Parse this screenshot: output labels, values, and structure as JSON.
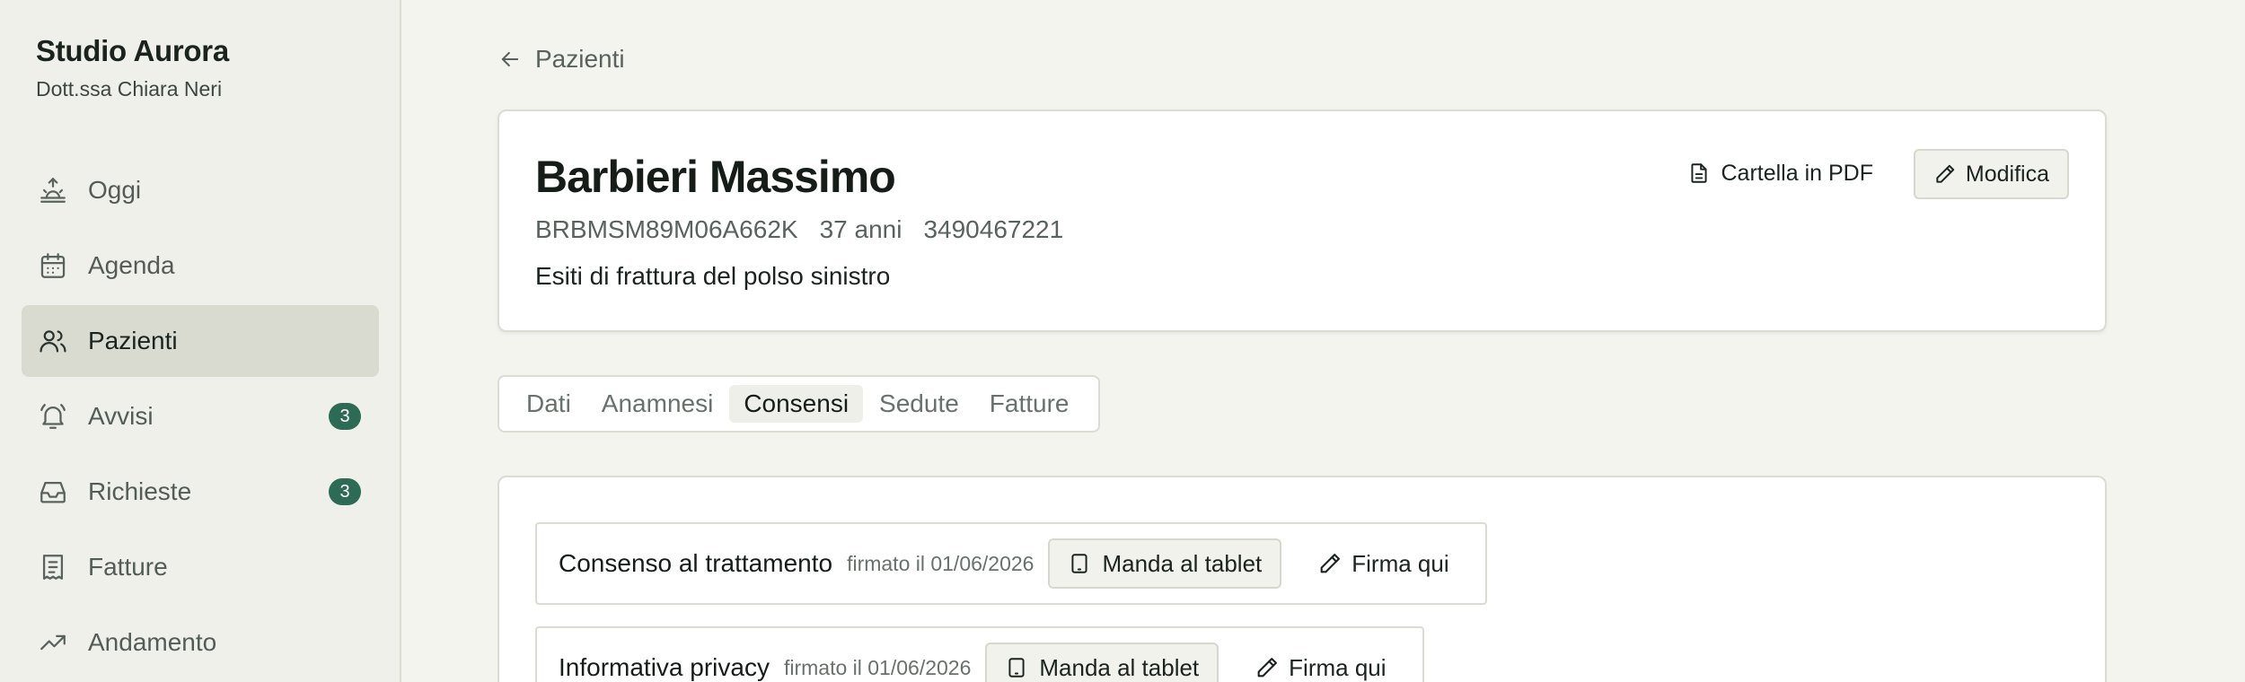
{
  "sidebar": {
    "brand": "Studio Aurora",
    "subtitle": "Dott.ssa Chiara Neri",
    "items": [
      {
        "label": "Oggi",
        "icon": "sunrise-icon"
      },
      {
        "label": "Agenda",
        "icon": "calendar-icon"
      },
      {
        "label": "Pazienti",
        "icon": "users-icon",
        "active": true
      },
      {
        "label": "Avvisi",
        "icon": "bell-icon",
        "badge": "3"
      },
      {
        "label": "Richieste",
        "icon": "inbox-icon",
        "badge": "3"
      },
      {
        "label": "Fatture",
        "icon": "receipt-icon"
      },
      {
        "label": "Andamento",
        "icon": "trending-up-icon"
      }
    ]
  },
  "breadcrumb": {
    "back_label": "Pazienti",
    "icon": "arrow-left-icon"
  },
  "patient": {
    "name": "Barbieri Massimo",
    "fiscal_code": "BRBMSM89M06A662K",
    "age": "37 anni",
    "phone": "3490467221",
    "diagnosis": "Esiti di frattura del polso sinistro",
    "pdf_label": "Cartella in PDF",
    "edit_label": "Modifica"
  },
  "tabs": [
    {
      "label": "Dati"
    },
    {
      "label": "Anamnesi"
    },
    {
      "label": "Consensi",
      "active": true
    },
    {
      "label": "Sedute"
    },
    {
      "label": "Fatture"
    }
  ],
  "consents": [
    {
      "title": "Consenso al trattamento",
      "date": "firmato il 01/06/2026",
      "tablet_label": "Manda al tablet",
      "sign_label": "Firma qui"
    },
    {
      "title": "Informativa privacy",
      "date": "firmato il 01/06/2026",
      "tablet_label": "Manda al tablet",
      "sign_label": "Firma qui"
    }
  ],
  "colors": {
    "accent": "#2e6b57",
    "sidebar_bg": "#f0f0ea",
    "active_nav_bg": "#d9dbd0",
    "page_bg": "#f4f4ef"
  }
}
